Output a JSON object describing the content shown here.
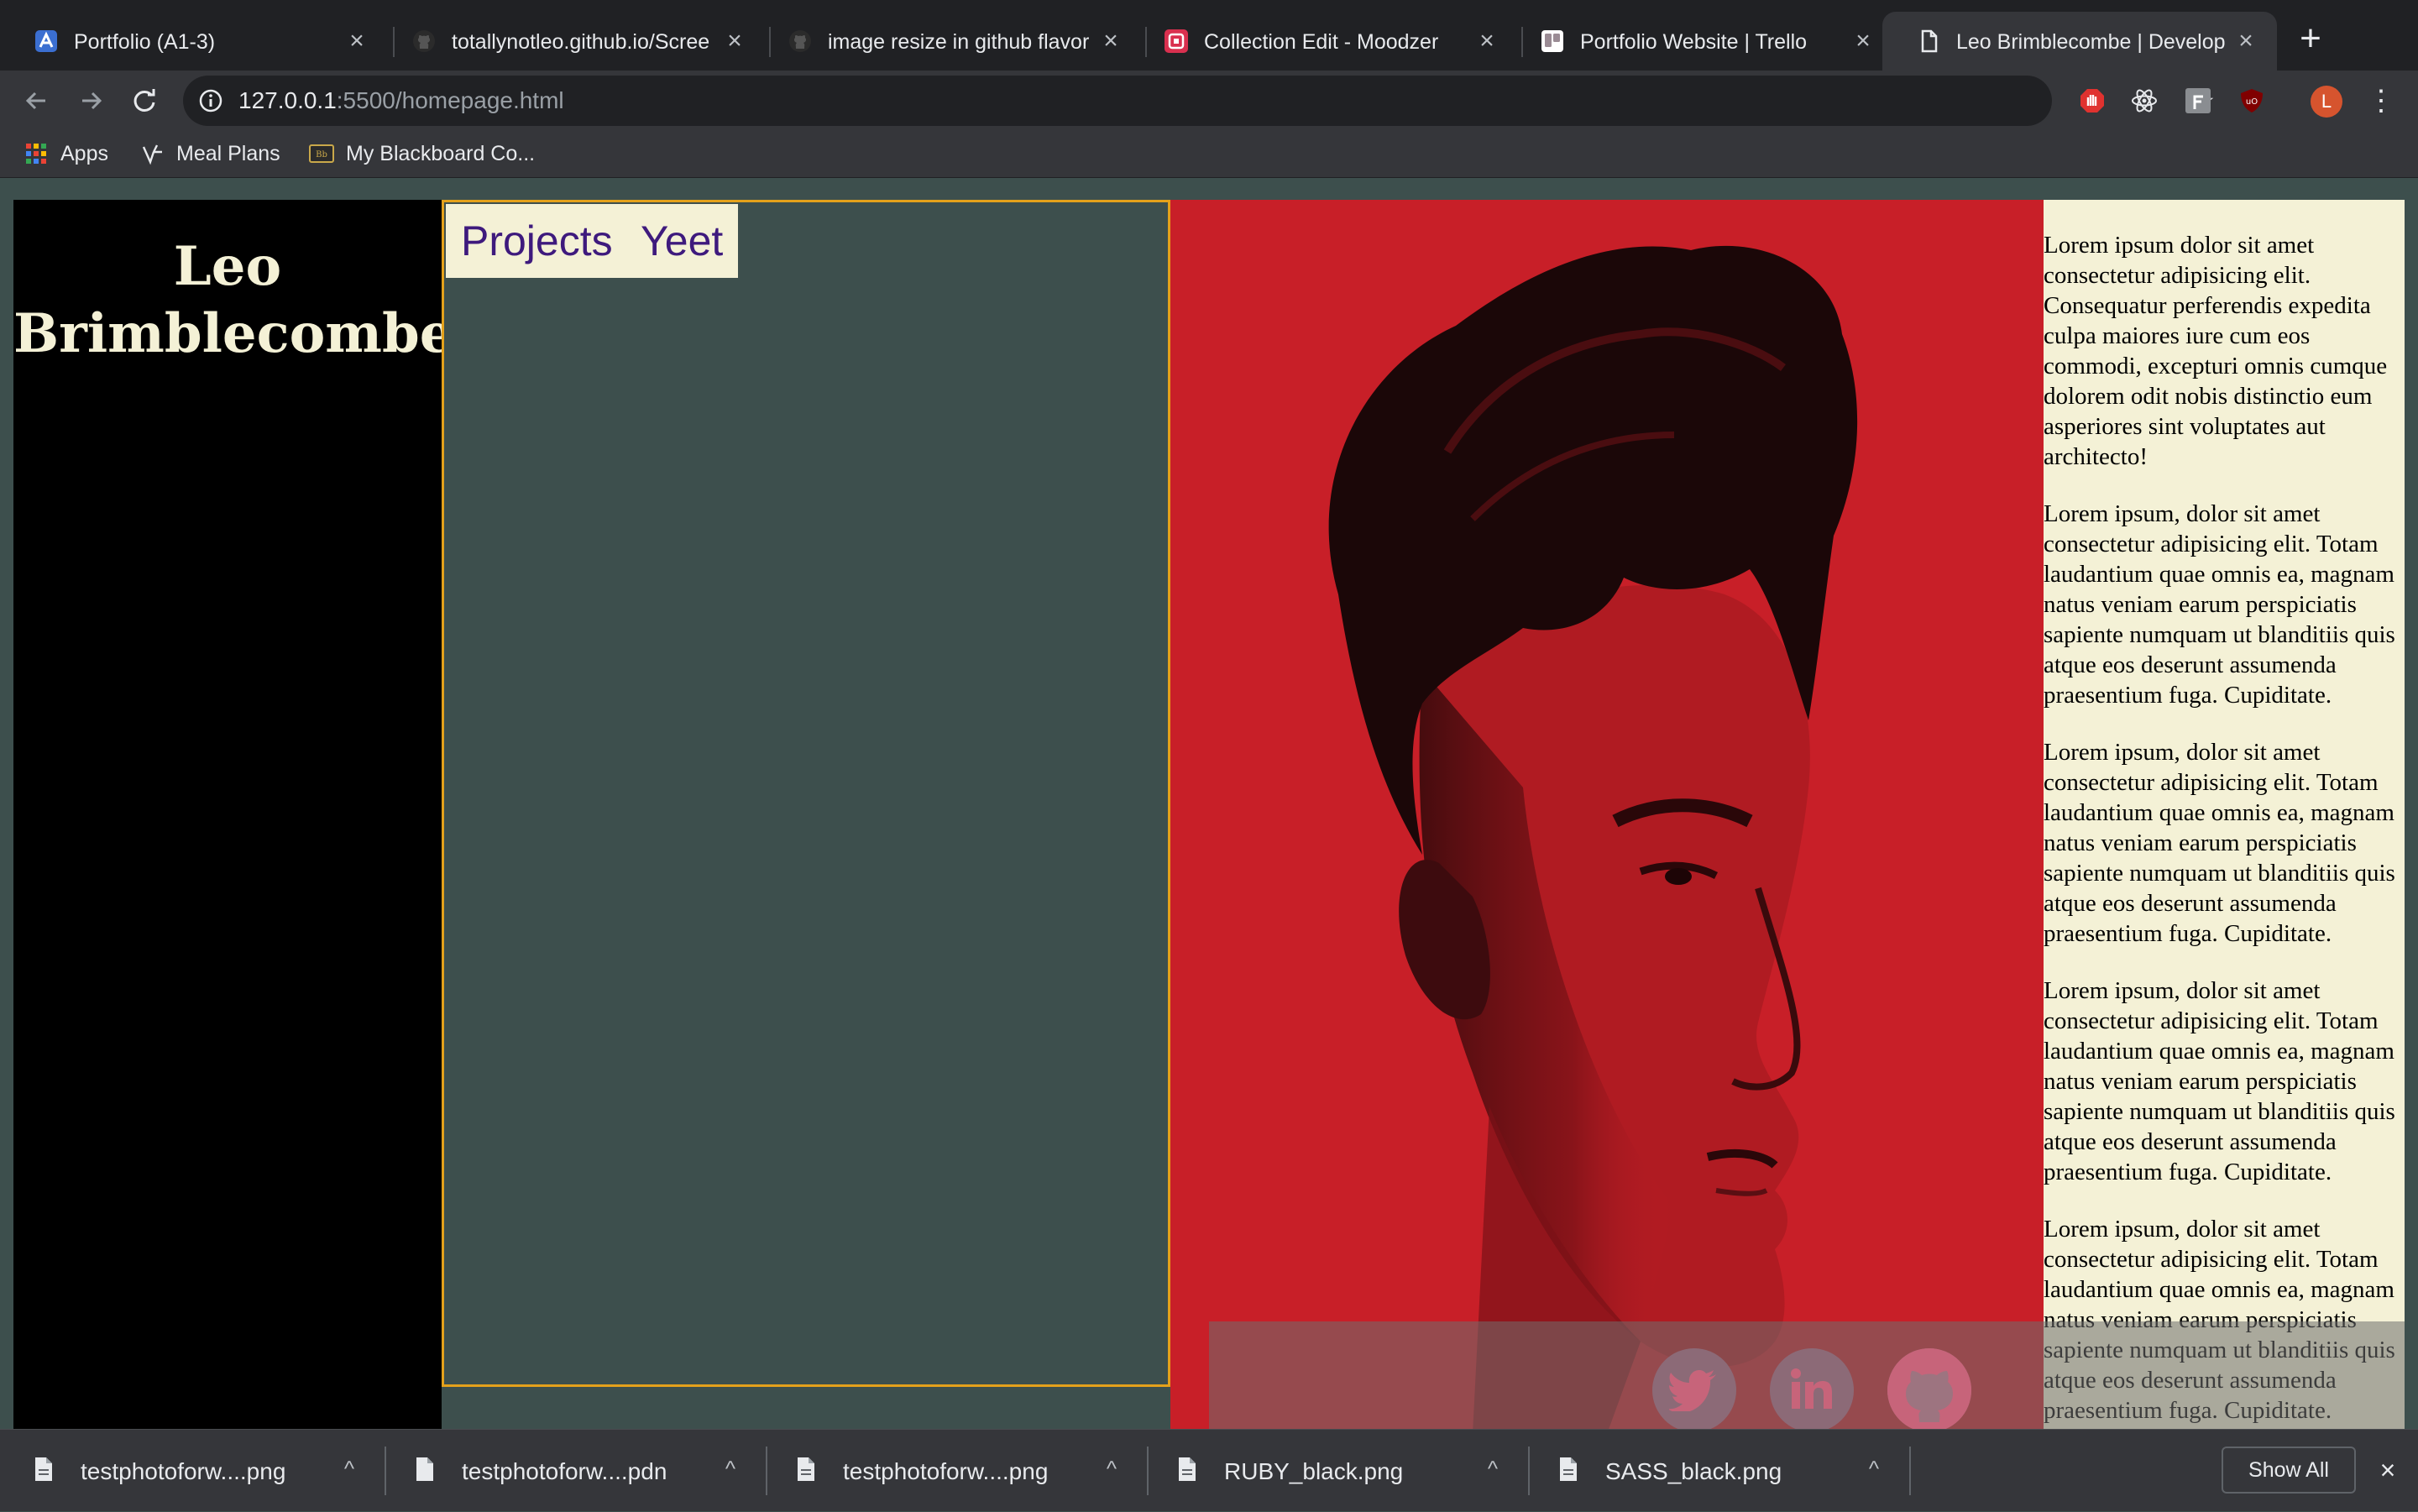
{
  "tabs": [
    {
      "title": "Portfolio (A1-3)",
      "icon": "portfolio-favicon"
    },
    {
      "title": "totallynotleo.github.io/Scree",
      "icon": "github-icon"
    },
    {
      "title": "image resize in github flavor",
      "icon": "github-icon"
    },
    {
      "title": "Collection Edit - Moodzer",
      "icon": "moodzer-favicon"
    },
    {
      "title": "Portfolio Website | Trello",
      "icon": "trello-icon"
    },
    {
      "title": "Leo Brimblecombe | Develop",
      "icon": "page-icon",
      "active": true
    }
  ],
  "toolbar": {
    "url_host": "127.0.0.1",
    "url_rest": ":5500/homepage.html",
    "avatar_letter": "L"
  },
  "bookmarks": [
    {
      "label": "Apps",
      "icon": "apps-grid-icon"
    },
    {
      "label": "Meal Plans",
      "icon": "mealplans-icon"
    },
    {
      "label": "My Blackboard Co...",
      "icon": "blackboard-icon"
    }
  ],
  "page": {
    "site_name": "Leo Brimblecombe",
    "nav": [
      "Projects",
      "Yeet"
    ],
    "paragraphs": [
      "Lorem ipsum dolor sit amet consectetur adipisicing elit. Consequatur perferendis expedita culpa maiores iure cum eos commodi, excepturi omnis cumque dolorem odit nobis distinctio eum asperiores sint voluptates aut architecto!",
      "Lorem ipsum, dolor sit amet consectetur adipisicing elit. Totam laudantium quae omnis ea, magnam natus veniam earum perspiciatis sapiente numquam ut blanditiis quis atque eos deserunt assumenda praesentium fuga. Cupiditate.",
      "Lorem ipsum, dolor sit amet consectetur adipisicing elit. Totam laudantium quae omnis ea, magnam natus veniam earum perspiciatis sapiente numquam ut blanditiis quis atque eos deserunt assumenda praesentium fuga. Cupiditate.",
      "Lorem ipsum, dolor sit amet consectetur adipisicing elit. Totam laudantium quae omnis ea, magnam natus veniam earum perspiciatis sapiente numquam ut blanditiis quis atque eos deserunt assumenda praesentium fuga. Cupiditate.",
      "Lorem ipsum, dolor sit amet consectetur adipisicing elit. Totam laudantium quae omnis ea, magnam natus veniam earum perspiciatis sapiente numquam ut blanditiis quis atque eos deserunt assumenda praesentium fuga. Cupiditate."
    ],
    "social": [
      "twitter-icon",
      "linkedin-icon",
      "github-icon"
    ],
    "colors": {
      "sidebar": "#000000",
      "nav_bg": "#3d4f4d",
      "nav_border": "#e4a11b",
      "photo_bg": "#c81f28",
      "text_bg": "#f4f1d6",
      "link_text": "#3e1a7d"
    }
  },
  "downloads": {
    "items": [
      "testphotoforw....png",
      "testphotoforw....pdn",
      "testphotoforw....png",
      "RUBY_black.png",
      "SASS_black.png"
    ],
    "show_all": "Show All"
  }
}
